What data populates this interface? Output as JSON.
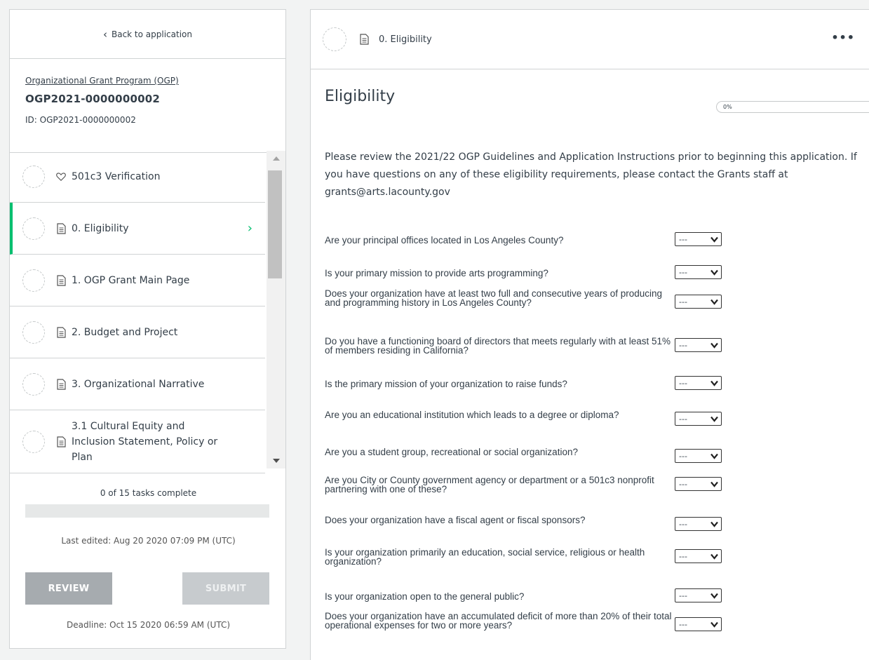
{
  "sidebar": {
    "back_label": "Back to application",
    "program_link": "Organizational Grant Program (OGP)",
    "app_title": "OGP2021-0000000002",
    "app_id": "ID: OGP2021-0000000002",
    "tasks": [
      {
        "label": "501c3 Verification",
        "icon": "heart-icon"
      },
      {
        "label": "0. Eligibility",
        "icon": "document-icon"
      },
      {
        "label": "1. OGP Grant Main Page",
        "icon": "document-icon"
      },
      {
        "label": "2. Budget and Project",
        "icon": "document-icon"
      },
      {
        "label": "3. Organizational Narrative",
        "icon": "document-icon"
      },
      {
        "label": "3.1 Cultural Equity and Inclusion Statement, Policy or Plan",
        "icon": "document-icon"
      }
    ],
    "progress_text": "0 of 15 tasks complete",
    "progress_value": 0,
    "last_edited": "Last edited: Aug 20 2020 07:09 PM (UTC)",
    "review_label": "REVIEW",
    "submit_label": "SUBMIT",
    "deadline": "Deadline: Oct 15 2020 06:59 AM (UTC)"
  },
  "main": {
    "header_title": "0. Eligibility",
    "more_label": "•••",
    "page_title": "Eligibility",
    "percent": "0%",
    "intro": "Please review the 2021/22 OGP Guidelines and Application Instructions prior to beginning this application. If you have questions on any of these eligibility requirements, please contact the Grants staff at grants@arts.lacounty.gov",
    "select_default": "---",
    "questions": [
      "Are your principal offices located in Los Angeles County?",
      "Is your primary mission to provide arts programming?",
      "Does your organization have at least two full and consecutive years of producing and programming history in Los Angeles County?",
      "Do you have a functioning board of directors that meets regularly with at least 51% of members residing in California?",
      "Is the primary mission of your organization to raise funds?",
      "Are you an educational institution which leads to a degree or diploma?",
      "Are you a student group, recreational or social organization?",
      "Are you City or County government agency or department or a 501c3 nonprofit partnering with one of these?",
      "Does your organization have a fiscal agent or fiscal sponsors?",
      "Is your organization primarily an education, social service, religious or health organization?",
      "Is your organization open to the general public?",
      "Does your organization have an accumulated deficit of more than 20% of their total operational expenses for two or more years?"
    ]
  }
}
